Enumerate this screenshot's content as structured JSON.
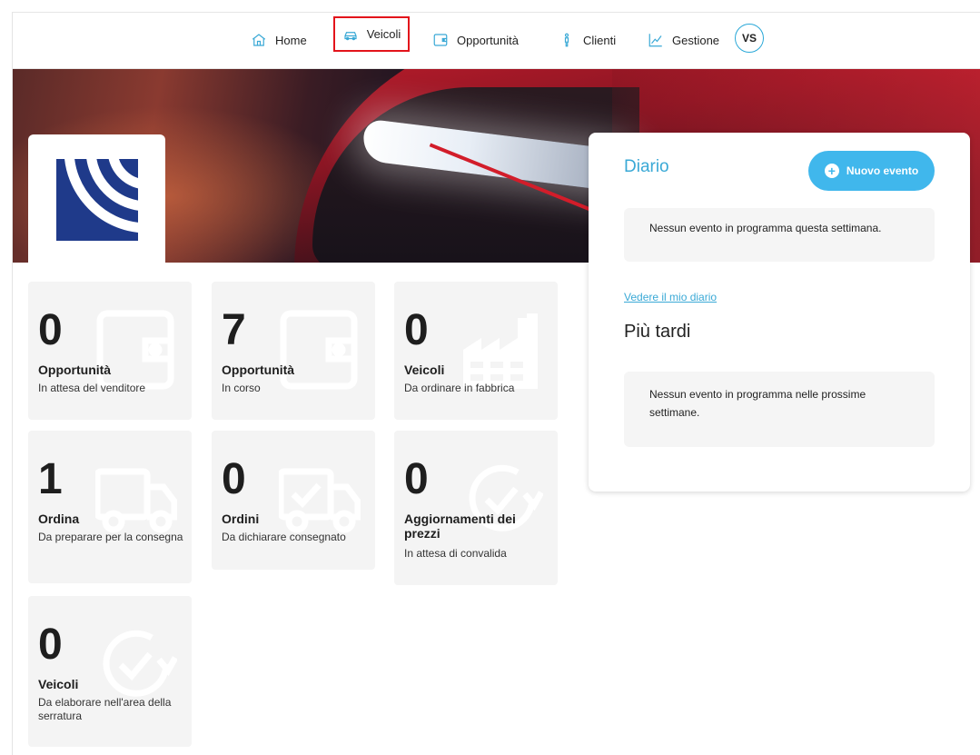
{
  "nav": {
    "items": [
      {
        "label": "Home",
        "icon": "home-icon"
      },
      {
        "label": "Veicoli",
        "icon": "car-icon"
      },
      {
        "label": "Opportunità",
        "icon": "wallet-icon"
      },
      {
        "label": "Clienti",
        "icon": "person-icon"
      },
      {
        "label": "Gestione",
        "icon": "chart-line-icon"
      }
    ],
    "avatar": "VS"
  },
  "colors": {
    "accent": "#40b7ec",
    "link": "#3aa9d6",
    "highlight_border": "#e3141b",
    "brand_logo": "#1f3a8a"
  },
  "tiles": [
    {
      "value": "0",
      "title": "Opportunità",
      "subtitle": "In attesa del venditore",
      "icon": "wallet-icon"
    },
    {
      "value": "7",
      "title": "Opportunità",
      "subtitle": "In corso",
      "icon": "wallet-icon"
    },
    {
      "value": "0",
      "title": "Veicoli",
      "subtitle": "Da ordinare in fabbrica",
      "icon": "factory-icon"
    },
    {
      "value": "1",
      "title": "Ordina",
      "subtitle": "Da preparare per la consegna",
      "icon": "truck-icon"
    },
    {
      "value": "0",
      "title": "Ordini",
      "subtitle": "Da dichiarare consegnato",
      "icon": "truck-check-icon"
    },
    {
      "value": "0",
      "title": "Aggiornamenti dei prezzi",
      "subtitle": "In attesa di convalida",
      "icon": "refresh-check-icon"
    },
    {
      "value": "0",
      "title": "Veicoli",
      "subtitle": "Da elaborare nell'area della serratura",
      "icon": "refresh-check-icon"
    }
  ],
  "diario": {
    "title": "Diario",
    "new_event_label": "Nuovo evento",
    "this_week_empty": "Nessun evento in programma questa settimana.",
    "see_diary_link": "Vedere il mio diario",
    "later_title": "Più tardi",
    "later_empty": "Nessun evento in programma nelle prossime settimane."
  }
}
